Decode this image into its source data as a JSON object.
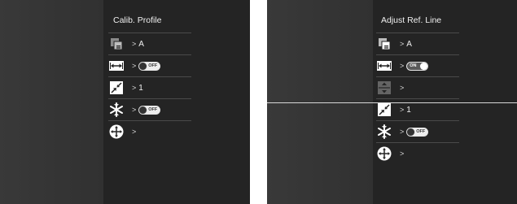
{
  "left_screen": {
    "title": "Calib. Profile",
    "rows": [
      {
        "icon": "calib-profile-icon",
        "chevron": ">",
        "value": "A"
      },
      {
        "icon": "horizontal-arrows-icon",
        "chevron": ">",
        "toggle": "OFF"
      },
      {
        "icon": "zoom-in-arrows-icon",
        "chevron": ">",
        "value": "1"
      },
      {
        "icon": "snowflake-icon",
        "chevron": ">",
        "toggle": "OFF"
      },
      {
        "icon": "move-cross-icon",
        "chevron": ">"
      }
    ]
  },
  "right_screen": {
    "title": "Adjust Ref. Line",
    "rows": [
      {
        "icon": "calib-profile-icon",
        "chevron": ">",
        "value": "A"
      },
      {
        "icon": "horizontal-arrows-icon",
        "chevron": ">",
        "toggle": "ON"
      },
      {
        "icon": "vertical-adjust-icon",
        "chevron": ">"
      },
      {
        "icon": "zoom-in-arrows-icon",
        "chevron": ">",
        "value": "1"
      },
      {
        "icon": "snowflake-icon",
        "chevron": ">",
        "toggle": "OFF"
      },
      {
        "icon": "move-cross-icon",
        "chevron": ">"
      }
    ]
  }
}
